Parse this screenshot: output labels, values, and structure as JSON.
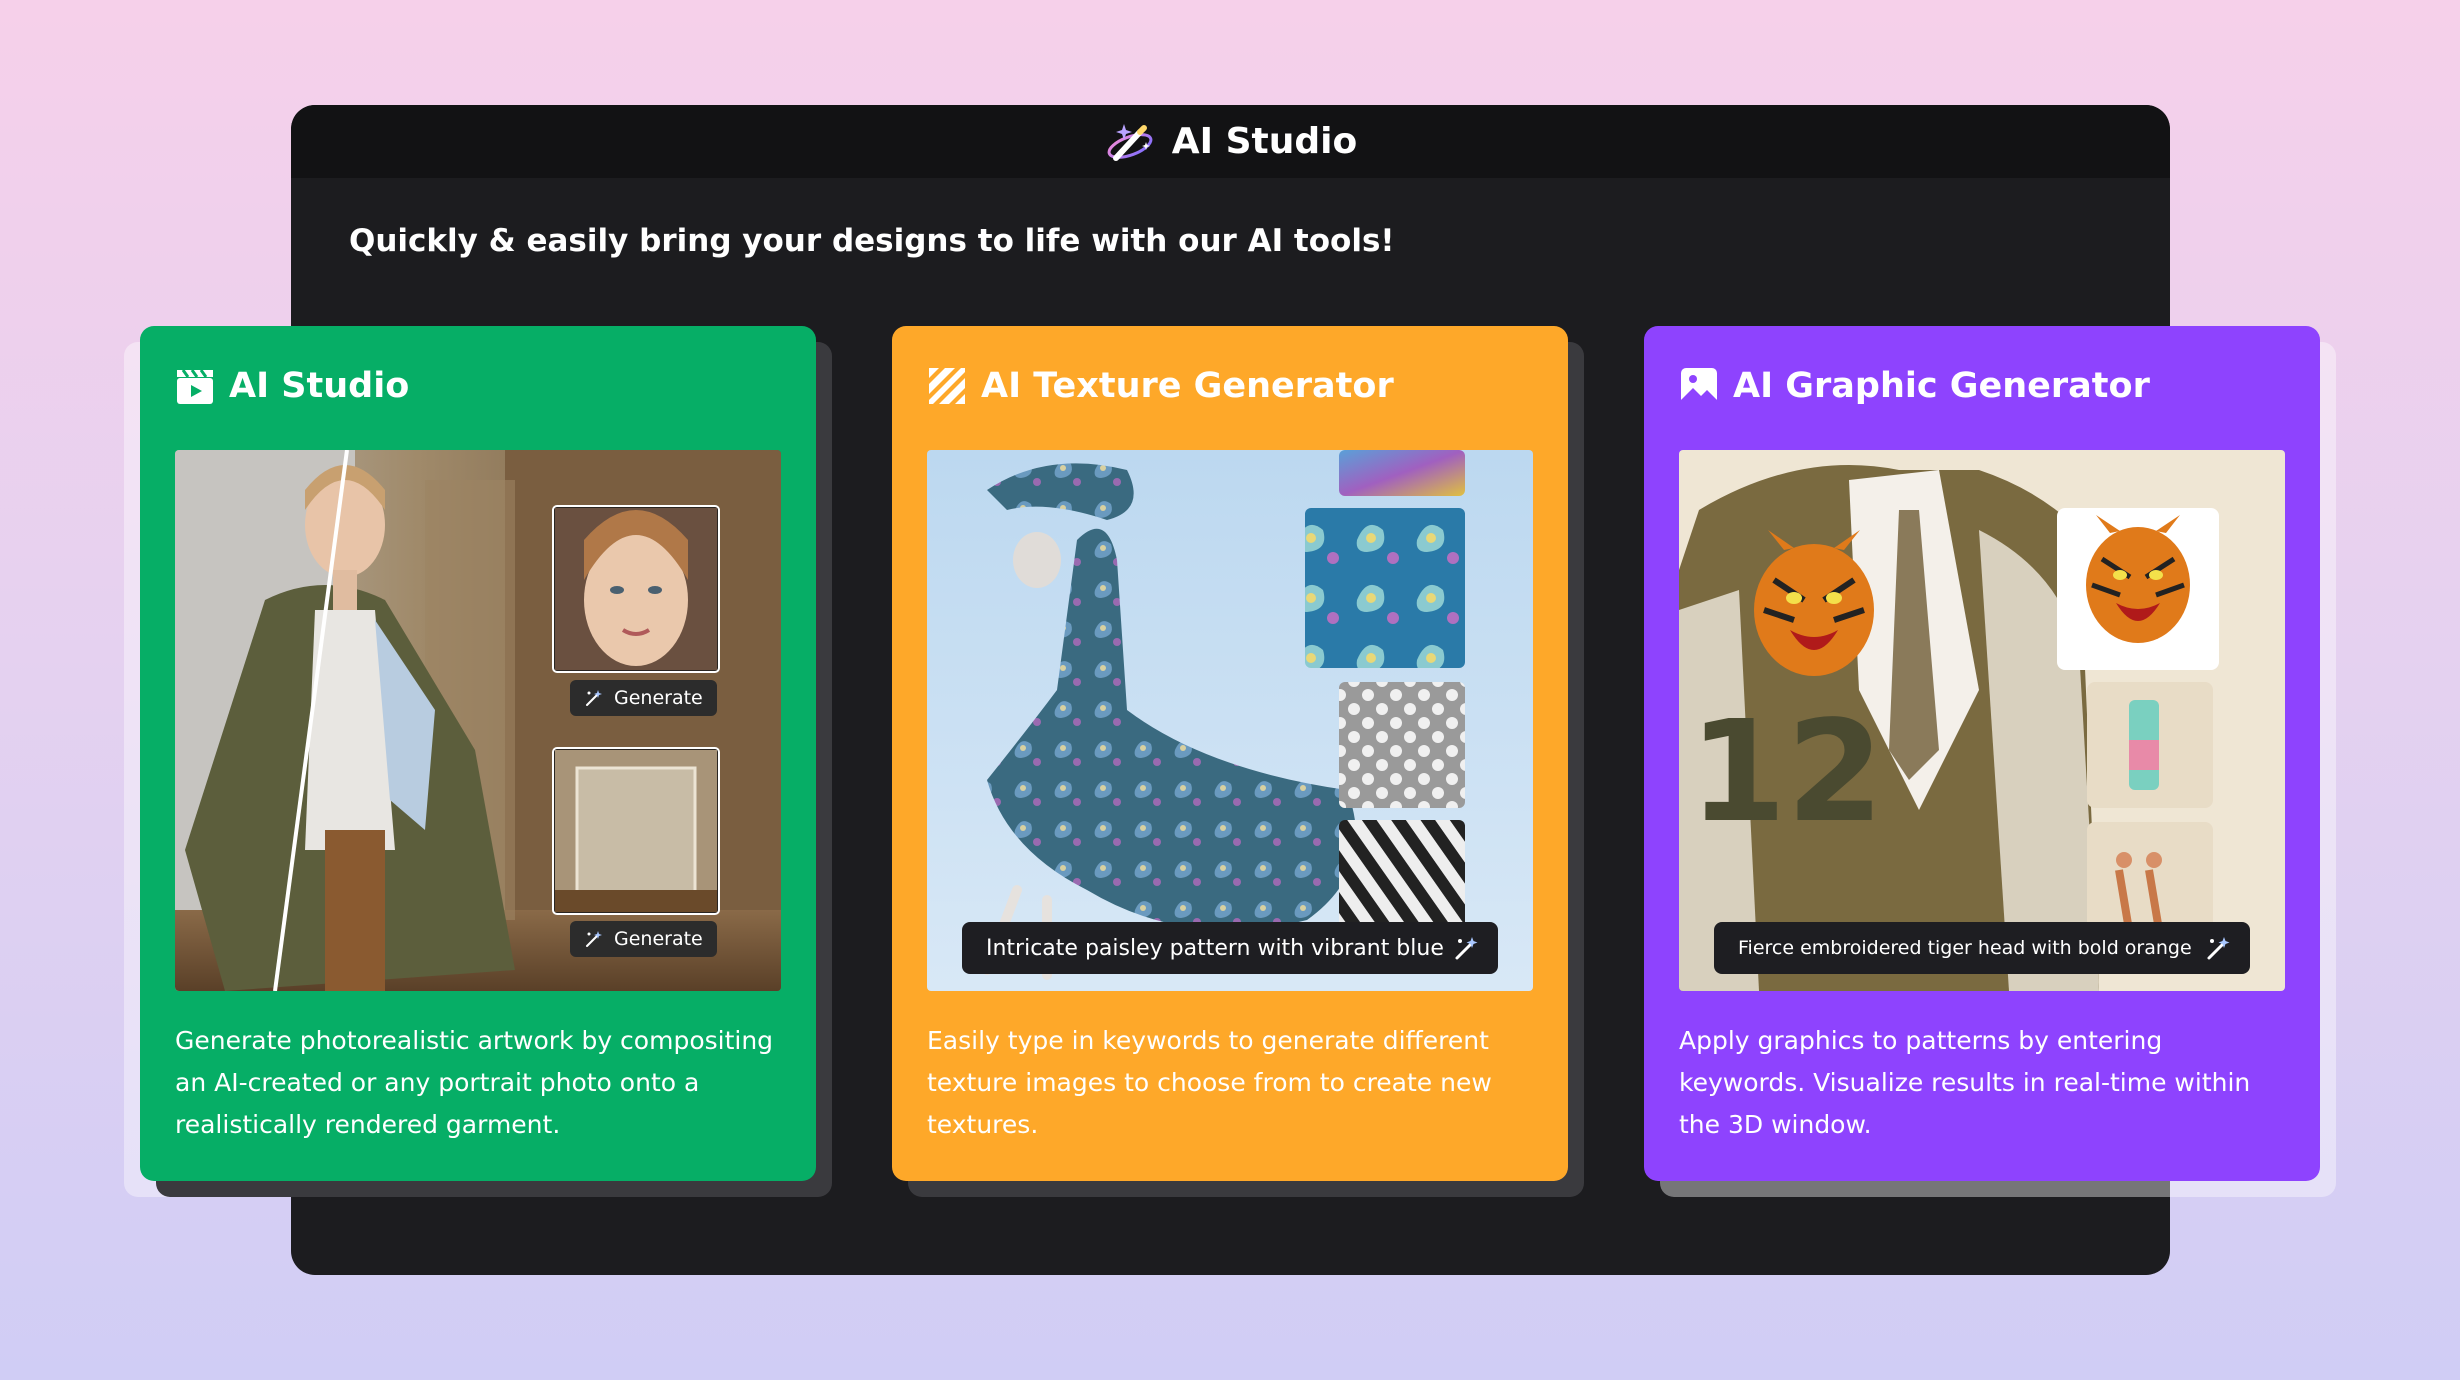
{
  "window": {
    "title": "AI Studio",
    "tagline": "Quickly & easily bring your designs to life with our AI tools!"
  },
  "cards": [
    {
      "title": "AI Studio",
      "icon": "clapperboard-icon",
      "description": "Generate photorealistic artwork by compositing an AI-created or any portrait photo onto a realistically rendered garment.",
      "generate_label": "Generate",
      "color": "#06ae66"
    },
    {
      "title": "AI Texture Generator",
      "icon": "texture-stripes-icon",
      "prompt": "Intricate paisley pattern with vibrant blue",
      "description": "Easily type in keywords to generate different texture images to choose from to create new textures.",
      "color": "#fea829"
    },
    {
      "title": "AI Graphic Generator",
      "icon": "image-icon",
      "prompt": "Fierce embroidered tiger head with bold orange",
      "description": "Apply graphics to patterns by entering keywords. Visualize results in real-time within the 3D window.",
      "color": "#8e43fe"
    }
  ]
}
